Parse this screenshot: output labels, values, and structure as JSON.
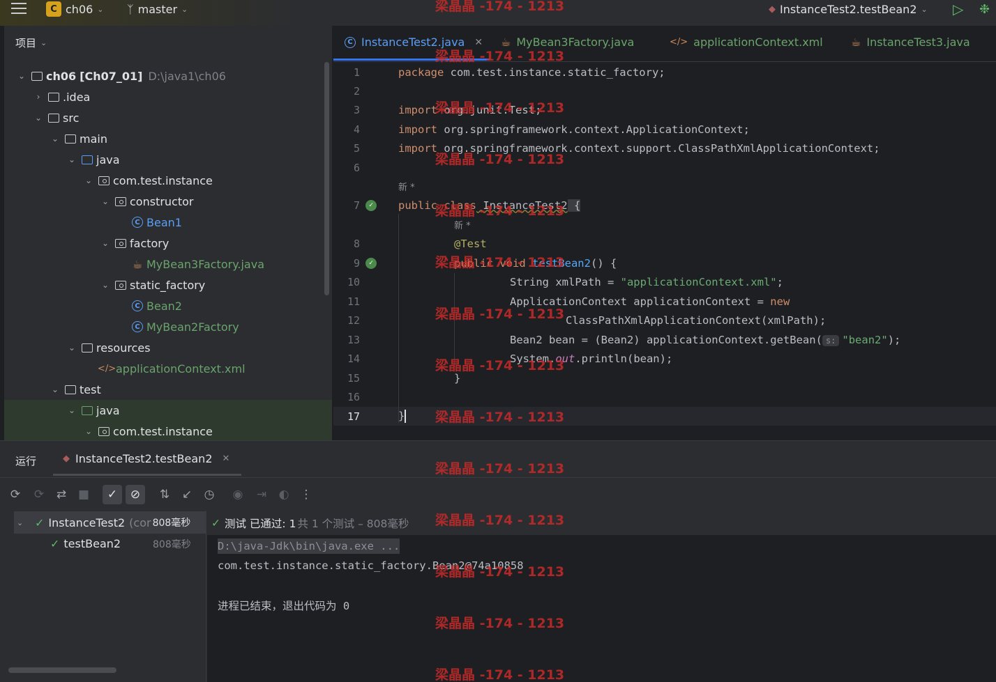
{
  "topbar": {
    "project_badge": "C",
    "project": "ch06",
    "branch": "master",
    "run_config": "InstanceTest2.testBean2"
  },
  "project_panel": {
    "title": "项目",
    "tree": [
      {
        "label": "ch06",
        "extra": "[Ch07_01]",
        "path": "D:\\java1\\ch06"
      },
      {
        "label": ".idea"
      },
      {
        "label": "src"
      },
      {
        "label": "main"
      },
      {
        "label": "java"
      },
      {
        "label": "com.test.instance"
      },
      {
        "label": "constructor"
      },
      {
        "label": "Bean1"
      },
      {
        "label": "factory"
      },
      {
        "label": "MyBean3Factory.java"
      },
      {
        "label": "static_factory"
      },
      {
        "label": "Bean2"
      },
      {
        "label": "MyBean2Factory"
      },
      {
        "label": "resources"
      },
      {
        "label": "applicationContext.xml"
      },
      {
        "label": "test"
      },
      {
        "label": "java"
      },
      {
        "label": "com.test.instance"
      }
    ]
  },
  "editor": {
    "tabs": [
      {
        "label": "InstanceTest2.java"
      },
      {
        "label": "MyBean3Factory.java"
      },
      {
        "label": "applicationContext.xml"
      },
      {
        "label": "InstanceTest3.java"
      }
    ],
    "line_numbers": [
      "1",
      "2",
      "3",
      "4",
      "5",
      "6",
      "7",
      "8",
      "9",
      "10",
      "11",
      "12",
      "13",
      "14",
      "15",
      "16",
      "17"
    ],
    "code": {
      "l1_kw": "package",
      "l1_rest": " com.test.instance.static_factory;",
      "l3_kw": "import",
      "l3_rest": " org.junit.Test;",
      "l4_kw": "import",
      "l4_rest": " org.springframework.context.ApplicationContext;",
      "l5_kw": "import",
      "l5_rest": " org.springframework.context.support.ClassPathXmlApplicationContext;",
      "hint_new": "新 *",
      "l7_kw": "public class",
      "l7_name": " InstanceTest2",
      "l7_rest": " {",
      "hint_new2": "新 *",
      "l8_ann": "@Test",
      "l9_kw": "public void",
      "l9_fn": " testBean2",
      "l9_rest": "() {",
      "l10_a": "String xmlPath = ",
      "l10_str": "\"applicationContext.xml\"",
      "l10_b": ";",
      "l11_a": "ApplicationContext applicationContext = ",
      "l11_kw": "new",
      "l12_a": "ClassPathXmlApplicationContext(xmlPath);",
      "l13_a": "Bean2 bean = (Bean2) applicationContext.getBean(",
      "l13_hint": "s:",
      "l13_str": "\"bean2\"",
      "l13_b": ");",
      "l14_a": "System.",
      "l14_static": "out",
      "l14_b": ".println(bean);",
      "l15_a": "}",
      "l17_a": "}"
    }
  },
  "run_panel": {
    "title": "运行",
    "tab": "InstanceTest2.testBean2",
    "tree": {
      "root": "InstanceTest2",
      "root_suffix": "(cor",
      "root_time": "808毫秒",
      "child": "testBean2",
      "child_time": "808毫秒"
    },
    "status": {
      "label": "测试 已通过: 1",
      "detail": "共 1 个测试 – 808毫秒"
    },
    "console": [
      "D:\\java-Jdk\\bin\\java.exe ...",
      "com.test.instance.static_factory.Bean2@74a10858",
      "",
      "进程已结束，退出代码为 0"
    ]
  },
  "watermark": "梁晶晶 -174 - 1213",
  "colors": {
    "accent": "#3574f0",
    "pass": "#5fb865",
    "keyword": "#cf8e6d",
    "string": "#6aab73"
  }
}
